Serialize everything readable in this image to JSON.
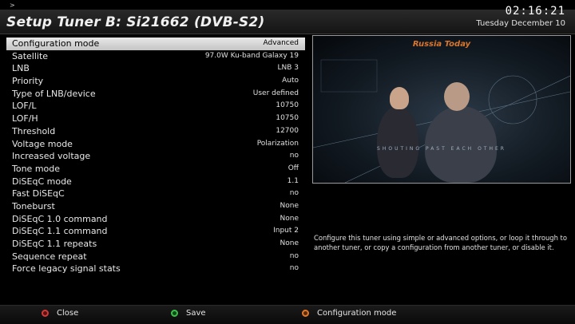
{
  "prompt": ">",
  "header": {
    "title": "Setup Tuner B: Si21662 (DVB-S2)",
    "time": "02:16:21",
    "date": "Tuesday December 10"
  },
  "settings": [
    {
      "label": "Configuration mode",
      "value": "Advanced",
      "selected": true
    },
    {
      "label": "Satellite",
      "value": "97.0W Ku-band Galaxy 19"
    },
    {
      "label": "LNB",
      "value": "LNB 3"
    },
    {
      "label": "Priority",
      "value": "Auto"
    },
    {
      "label": "Type of LNB/device",
      "value": "User defined"
    },
    {
      "label": "LOF/L",
      "value": "10750"
    },
    {
      "label": "LOF/H",
      "value": "10750"
    },
    {
      "label": "Threshold",
      "value": "12700"
    },
    {
      "label": "Voltage mode",
      "value": "Polarization"
    },
    {
      "label": "Increased voltage",
      "value": "no"
    },
    {
      "label": "Tone mode",
      "value": "Off"
    },
    {
      "label": "DiSEqC mode",
      "value": "1.1"
    },
    {
      "label": "Fast DiSEqC",
      "value": "no"
    },
    {
      "label": "Toneburst",
      "value": "None"
    },
    {
      "label": "DiSEqC 1.0 command",
      "value": "None"
    },
    {
      "label": "DiSEqC 1.1 command",
      "value": "Input 2"
    },
    {
      "label": "DiSEqC 1.1 repeats",
      "value": "None"
    },
    {
      "label": "Sequence repeat",
      "value": "no"
    },
    {
      "label": "Force legacy signal stats",
      "value": "no"
    }
  ],
  "preview": {
    "channel_logo": "Russia Today",
    "strip_text": "SHOUTING PAST EACH OTHER"
  },
  "help_text": "Configure this tuner using simple or advanced options, or loop it through to another tuner, or copy a configuration from another tuner, or disable it.",
  "buttons": {
    "red": "Close",
    "green": "Save",
    "yellow": "Configuration mode"
  },
  "colors": {
    "red_key": "#d23a3a",
    "green_key": "#3cbf4a",
    "yellow_key": "#e0782a",
    "selection": "#d8d8d8"
  }
}
